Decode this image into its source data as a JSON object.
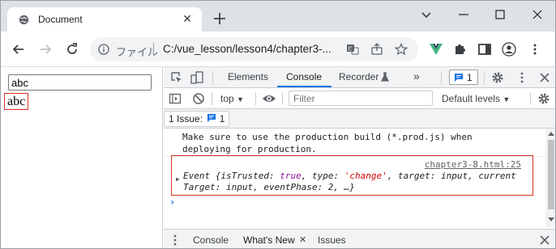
{
  "browser": {
    "tab_title": "Document",
    "tab_close": "✕",
    "new_tab_icon": "plus-icon",
    "window_controls": [
      "chevron-down-icon",
      "minimize-icon",
      "maximize-icon",
      "close-icon"
    ]
  },
  "address_bar": {
    "file_label": "ファイル",
    "url": "C:/vue_lesson/lesson4/chapter3-...",
    "icons": [
      "translate-icon",
      "share-icon",
      "star-icon"
    ]
  },
  "extensions": [
    "vue-devtools-icon",
    "puzzle-icon",
    "side-panel-icon",
    "profile-icon",
    "more-vert-icon"
  ],
  "page": {
    "input_value": "abc",
    "output_text": "abc"
  },
  "devtools": {
    "tabs": [
      "Elements",
      "Console",
      "Recorder",
      "»"
    ],
    "active_tab": "Console",
    "issues_count": "1",
    "context": "top",
    "filter_placeholder": "Filter",
    "levels": "Default levels",
    "issues_chip": "1 Issue:",
    "issues_chip_count": "1",
    "console": {
      "message_line1": "Make sure to use the production build (*.prod.js) when",
      "message_line2": "deploying for production.",
      "source_link": "chapter3-8.html:25",
      "event_name": "Event",
      "event_line2": "Target: input, eventPhase: 2, …}"
    },
    "drawer_tabs": [
      "Console",
      "What's New",
      "Issues"
    ],
    "drawer_close": "✕"
  },
  "colors": {
    "accent": "#1a73e8",
    "highlight_border": "#d93025",
    "vue_green": "#41b883"
  }
}
